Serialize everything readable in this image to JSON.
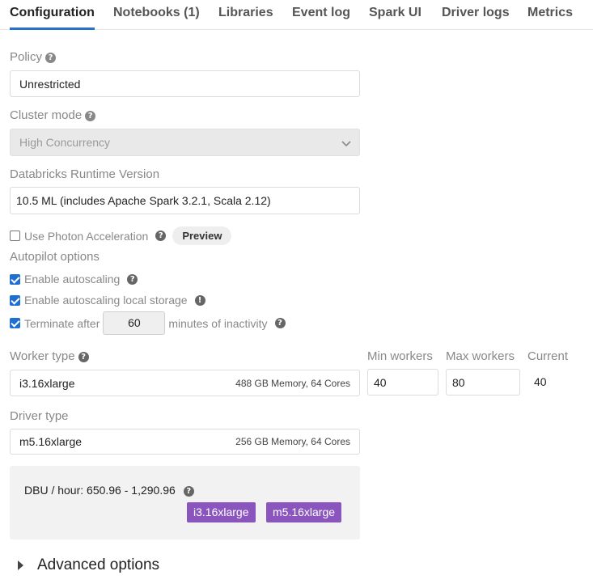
{
  "tabs": [
    {
      "label": "Configuration",
      "active": true
    },
    {
      "label": "Notebooks (1)",
      "active": false
    },
    {
      "label": "Libraries",
      "active": false
    },
    {
      "label": "Event log",
      "active": false
    },
    {
      "label": "Spark UI",
      "active": false
    },
    {
      "label": "Driver logs",
      "active": false
    },
    {
      "label": "Metrics",
      "active": false
    }
  ],
  "policy": {
    "label": "Policy",
    "value": "Unrestricted"
  },
  "cluster_mode": {
    "label": "Cluster mode",
    "value": "High Concurrency"
  },
  "runtime": {
    "label": "Databricks Runtime Version",
    "value": "10.5 ML (includes Apache Spark 3.2.1, Scala 2.12)"
  },
  "photon": {
    "label": "Use Photon Acceleration",
    "checked": false,
    "badge": "Preview"
  },
  "autopilot": {
    "heading": "Autopilot options",
    "autoscaling": {
      "label": "Enable autoscaling",
      "checked": true
    },
    "local_storage": {
      "label": "Enable autoscaling local storage",
      "checked": true
    },
    "terminate": {
      "prefix": "Terminate after",
      "minutes": "60",
      "suffix": "minutes of inactivity",
      "checked": true
    }
  },
  "worker": {
    "label": "Worker type",
    "value": "i3.16xlarge",
    "specs": "488 GB Memory, 64 Cores",
    "min_label": "Min workers",
    "min_value": "40",
    "max_label": "Max workers",
    "max_value": "80",
    "current_label": "Current",
    "current_value": "40"
  },
  "driver": {
    "label": "Driver type",
    "value": "m5.16xlarge",
    "specs": "256 GB Memory, 64 Cores"
  },
  "dbu": {
    "text": "DBU / hour: 650.96 - 1,290.96",
    "badges": [
      "i3.16xlarge",
      "m5.16xlarge"
    ],
    "badge_color": "#8a55bd"
  },
  "advanced": {
    "label": "Advanced options"
  },
  "colors": {
    "accent": "#2a72c9",
    "checkbox": "#1f6fd3"
  }
}
